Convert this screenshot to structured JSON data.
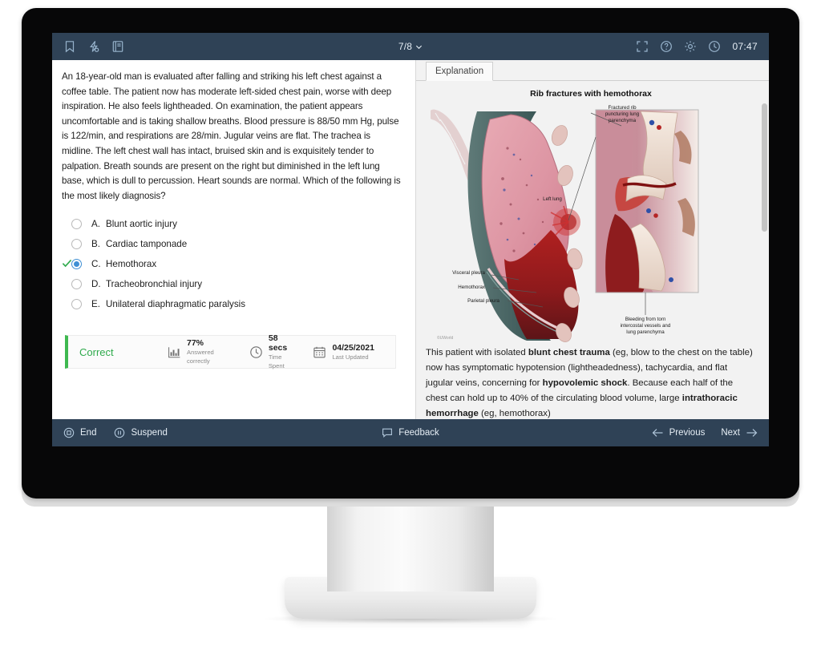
{
  "topbar": {
    "icons": [
      {
        "name": "bookmark-icon",
        "label": "Bookmark"
      },
      {
        "name": "lab-values-icon",
        "label": "Lab Values"
      },
      {
        "name": "notebook-icon",
        "label": "Notebook"
      }
    ],
    "page_counter": "7/8",
    "chevron": "⌄",
    "fullscreen_label": "Fullscreen",
    "help_label": "Help",
    "settings_label": "Settings",
    "timer": "07:47"
  },
  "question": {
    "stem": "An 18-year-old man is evaluated after falling and striking his left chest against a coffee table.  The patient now has moderate left-sided chest pain, worse with deep inspiration.  He also feels lightheaded.  On examination, the patient appears uncomfortable and is taking shallow breaths.  Blood pressure is 88/50 mm Hg, pulse is 122/min, and respirations are 28/min.  Jugular veins are flat.  The trachea is midline.  The left chest wall has intact, bruised skin and is exquisitely tender to palpation.  Breath sounds are present on the right but diminished in the left lung base, which is dull to percussion.  Heart sounds are normal.  Which of the following is the most likely diagnosis?",
    "choices": [
      {
        "letter": "A.",
        "text": "Blunt aortic injury",
        "selected": false,
        "correct": false
      },
      {
        "letter": "B.",
        "text": "Cardiac tamponade",
        "selected": false,
        "correct": false
      },
      {
        "letter": "C.",
        "text": "Hemothorax",
        "selected": true,
        "correct": true
      },
      {
        "letter": "D.",
        "text": "Tracheobronchial injury",
        "selected": false,
        "correct": false
      },
      {
        "letter": "E.",
        "text": "Unilateral diaphragmatic paralysis",
        "selected": false,
        "correct": false
      }
    ]
  },
  "stats": {
    "verdict": "Correct",
    "verdict_color": "#2faa4c",
    "items": [
      {
        "icon": "bar-chart-icon",
        "value": "77%",
        "label": "Answered correctly"
      },
      {
        "icon": "clock-icon",
        "value": "58 secs",
        "label": "Time Spent"
      },
      {
        "icon": "calendar-icon",
        "value": "04/25/2021",
        "label": "Last Updated"
      }
    ]
  },
  "explanation": {
    "tab_label": "Explanation",
    "figure_title": "Rib fractures with hemothorax",
    "figure_labels": {
      "left_lung": "Left lung",
      "fractured_rib": "Fractured rib\npuncturing lung\nparenchyma",
      "visceral_pleura": "Visceral pleura",
      "hemothorax": "Hemothorax",
      "parietal_pleura": "Parietal pleura",
      "bleeding": "Bleeding from torn\nintercostal vessels and\nlung parenchyma"
    },
    "copyright": "©UWorld",
    "paragraph": [
      {
        "t": "This patient with isolated ",
        "b": false
      },
      {
        "t": "blunt chest trauma",
        "b": true
      },
      {
        "t": " (eg, blow to the chest on the table) now has symptomatic hypotension (lightheadedness), tachycardia, and flat jugular veins, concerning for ",
        "b": false
      },
      {
        "t": "hypovolemic shock",
        "b": true
      },
      {
        "t": ".  Because each half of the chest can hold up to 40% of the circulating blood volume, large ",
        "b": false
      },
      {
        "t": "intrathoracic hemorrhage",
        "b": true
      },
      {
        "t": " (eg, hemothorax)",
        "b": false
      }
    ]
  },
  "bottombar": {
    "end_label": "End",
    "suspend_label": "Suspend",
    "feedback_label": "Feedback",
    "previous_label": "Previous",
    "next_label": "Next"
  },
  "colors": {
    "bar_bg": "#2f4256",
    "accent_blue": "#3f8fd4",
    "correct_green": "#2faa4c",
    "pane_bg": "#f2f2f2"
  }
}
